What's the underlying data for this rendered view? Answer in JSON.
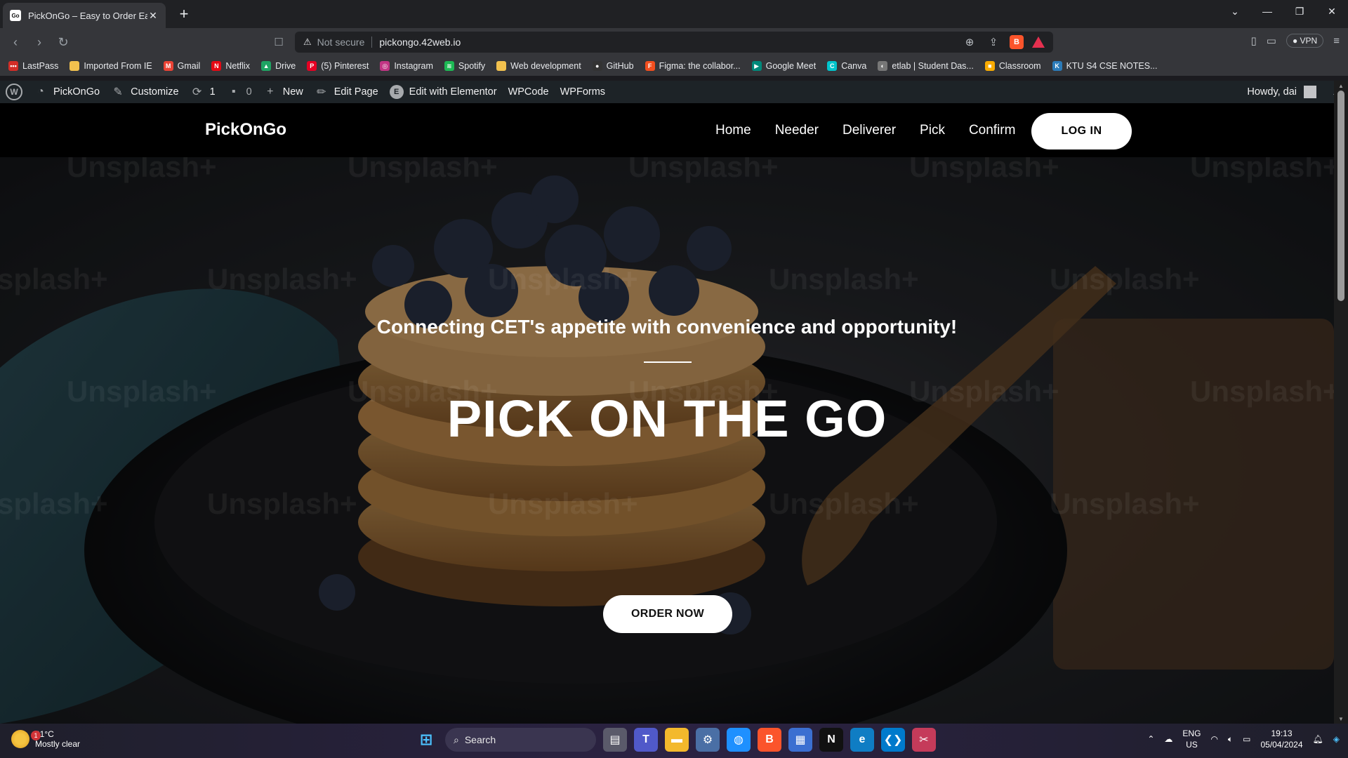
{
  "browser": {
    "tab_title": "PickOnGo – Easy to Order Easy",
    "tab_favicon": "Go",
    "address_security": "Not secure",
    "address_url": "pickongo.42web.io",
    "vpn_label": "VPN",
    "brave_badge": "B"
  },
  "bookmarks": [
    {
      "label": "LastPass",
      "icon": "lastpass-icon",
      "color": "#d32d27",
      "glyph": "•••"
    },
    {
      "label": "Imported From IE",
      "icon": "folder-icon",
      "color": "#f2c14e",
      "glyph": ""
    },
    {
      "label": "Gmail",
      "icon": "gmail-icon",
      "color": "#ea4335",
      "glyph": "M"
    },
    {
      "label": "Netflix",
      "icon": "netflix-icon",
      "color": "#e50914",
      "glyph": "N"
    },
    {
      "label": "Drive",
      "icon": "drive-icon",
      "color": "#1fa463",
      "glyph": "▲"
    },
    {
      "label": "(5) Pinterest",
      "icon": "pinterest-icon",
      "color": "#e60023",
      "glyph": "P"
    },
    {
      "label": "Instagram",
      "icon": "instagram-icon",
      "color": "#c13584",
      "glyph": "◎"
    },
    {
      "label": "Spotify",
      "icon": "spotify-icon",
      "color": "#1db954",
      "glyph": "≋"
    },
    {
      "label": "Web development",
      "icon": "folder-icon",
      "color": "#f2c14e",
      "glyph": ""
    },
    {
      "label": "GitHub",
      "icon": "github-icon",
      "color": "#333333",
      "glyph": "●"
    },
    {
      "label": "Figma: the collabor...",
      "icon": "figma-icon",
      "color": "#f24e1e",
      "glyph": "F"
    },
    {
      "label": "Google Meet",
      "icon": "google-meet-icon",
      "color": "#00897b",
      "glyph": "▶"
    },
    {
      "label": "Canva",
      "icon": "canva-icon",
      "color": "#00c4cc",
      "glyph": "C"
    },
    {
      "label": "etlab | Student Das...",
      "icon": "etlab-icon",
      "color": "#777777",
      "glyph": "◐"
    },
    {
      "label": "Classroom",
      "icon": "classroom-icon",
      "color": "#f9ab00",
      "glyph": "■"
    },
    {
      "label": "KTU S4 CSE NOTES...",
      "icon": "ktu-icon",
      "color": "#2b7bb9",
      "glyph": "K"
    }
  ],
  "wpbar": {
    "logo": "W",
    "site_name": "PickOnGo",
    "customize": "Customize",
    "updates_count": "1",
    "comments_count": "0",
    "new_label": "New",
    "edit_page": "Edit Page",
    "elementor": "Edit with Elementor",
    "elementor_glyph": "E",
    "wpcode": "WPCode",
    "wpforms": "WPForms",
    "howdy": "Howdy, dai"
  },
  "site": {
    "logo": "PickOnGo",
    "nav": [
      "Home",
      "Needer",
      "Deliverer",
      "Pick",
      "Confirm"
    ],
    "login_label": "LOG IN",
    "tagline": "Connecting CET's appetite with convenience and opportunity!",
    "headline": "PICK ON THE GO",
    "order_label": "ORDER NOW",
    "watermark": "Unsplash+"
  },
  "taskbar": {
    "temperature": "31°C",
    "weather": "Mostly clear",
    "weather_badge": "1",
    "search_label": "Search",
    "lang_line1": "ENG",
    "lang_line2": "US",
    "time": "19:13",
    "date": "05/04/2024",
    "apps": [
      {
        "name": "task-view-icon",
        "color": "#5a5a6a",
        "glyph": "▤"
      },
      {
        "name": "teams-icon",
        "color": "#5059c9",
        "glyph": "T"
      },
      {
        "name": "file-explorer-icon",
        "color": "#f3b92c",
        "glyph": "▬"
      },
      {
        "name": "settings-icon",
        "color": "#4a6fa5",
        "glyph": "⚙"
      },
      {
        "name": "safari-icon",
        "color": "#1e90ff",
        "glyph": "◍"
      },
      {
        "name": "brave-taskbar-icon",
        "color": "#fb542b",
        "glyph": "B"
      },
      {
        "name": "store-icon",
        "color": "#3b6fd1",
        "glyph": "▦"
      },
      {
        "name": "netflix-taskbar-icon",
        "color": "#111111",
        "glyph": "N"
      },
      {
        "name": "edge-icon",
        "color": "#0f7dc4",
        "glyph": "e"
      },
      {
        "name": "vscode-icon",
        "color": "#007acc",
        "glyph": "❮❯"
      },
      {
        "name": "snipping-tool-icon",
        "color": "#c53b5a",
        "glyph": "✂"
      }
    ]
  }
}
